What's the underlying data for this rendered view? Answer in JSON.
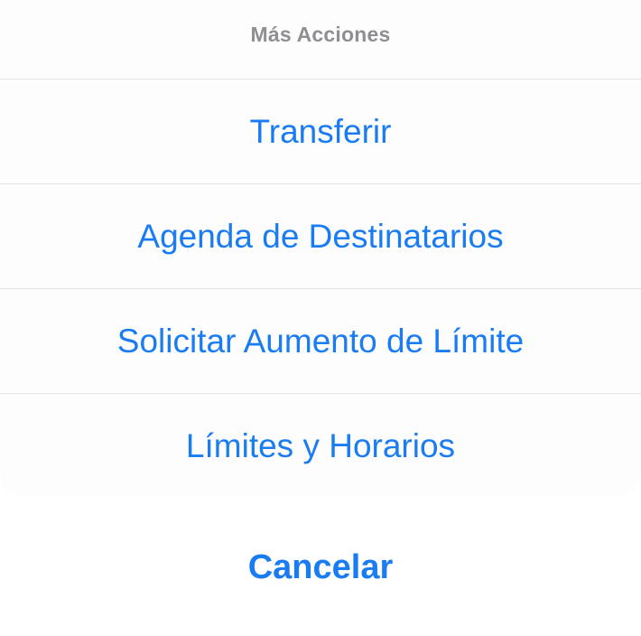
{
  "sheet": {
    "title": "Más Acciones",
    "actions": [
      {
        "label": "Transferir"
      },
      {
        "label": "Agenda de Destinatarios"
      },
      {
        "label": "Solicitar Aumento de Límite"
      },
      {
        "label": "Límites y Horarios"
      }
    ],
    "cancel_label": "Cancelar"
  },
  "colors": {
    "accent": "#1a7cf2",
    "title_gray": "#8e8e93",
    "separator": "#e4e4e7"
  }
}
